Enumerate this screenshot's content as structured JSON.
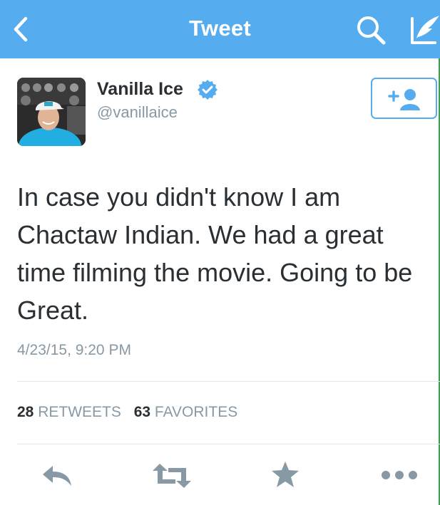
{
  "nav": {
    "title": "Tweet",
    "back_icon": "chevron-left-icon",
    "search_icon": "search-icon",
    "compose_icon": "compose-tweet-icon",
    "background_color": "#55acee"
  },
  "tweet": {
    "author_name": "Vanilla Ice",
    "author_handle": "@vanillaice",
    "verified": true,
    "text": "In case you didn't know I am Chactaw Indian. We had a great time filming the movie. Going to be Great.",
    "timestamp": "4/23/15, 9:20 PM",
    "retweets_count": "28",
    "retweets_label": "RETWEETS",
    "favorites_count": "63",
    "favorites_label": "FAVORITES"
  },
  "follow_button": {
    "icon": "follow-user-icon"
  },
  "actions": [
    {
      "name": "reply",
      "icon": "reply-icon"
    },
    {
      "name": "retweet",
      "icon": "retweet-icon"
    },
    {
      "name": "favorite",
      "icon": "star-icon"
    },
    {
      "name": "more",
      "icon": "more-icon"
    }
  ],
  "colors": {
    "accent": "#55acee",
    "text_primary": "#292f33",
    "text_secondary": "#8899a6",
    "icon_gray": "#8899a6"
  }
}
